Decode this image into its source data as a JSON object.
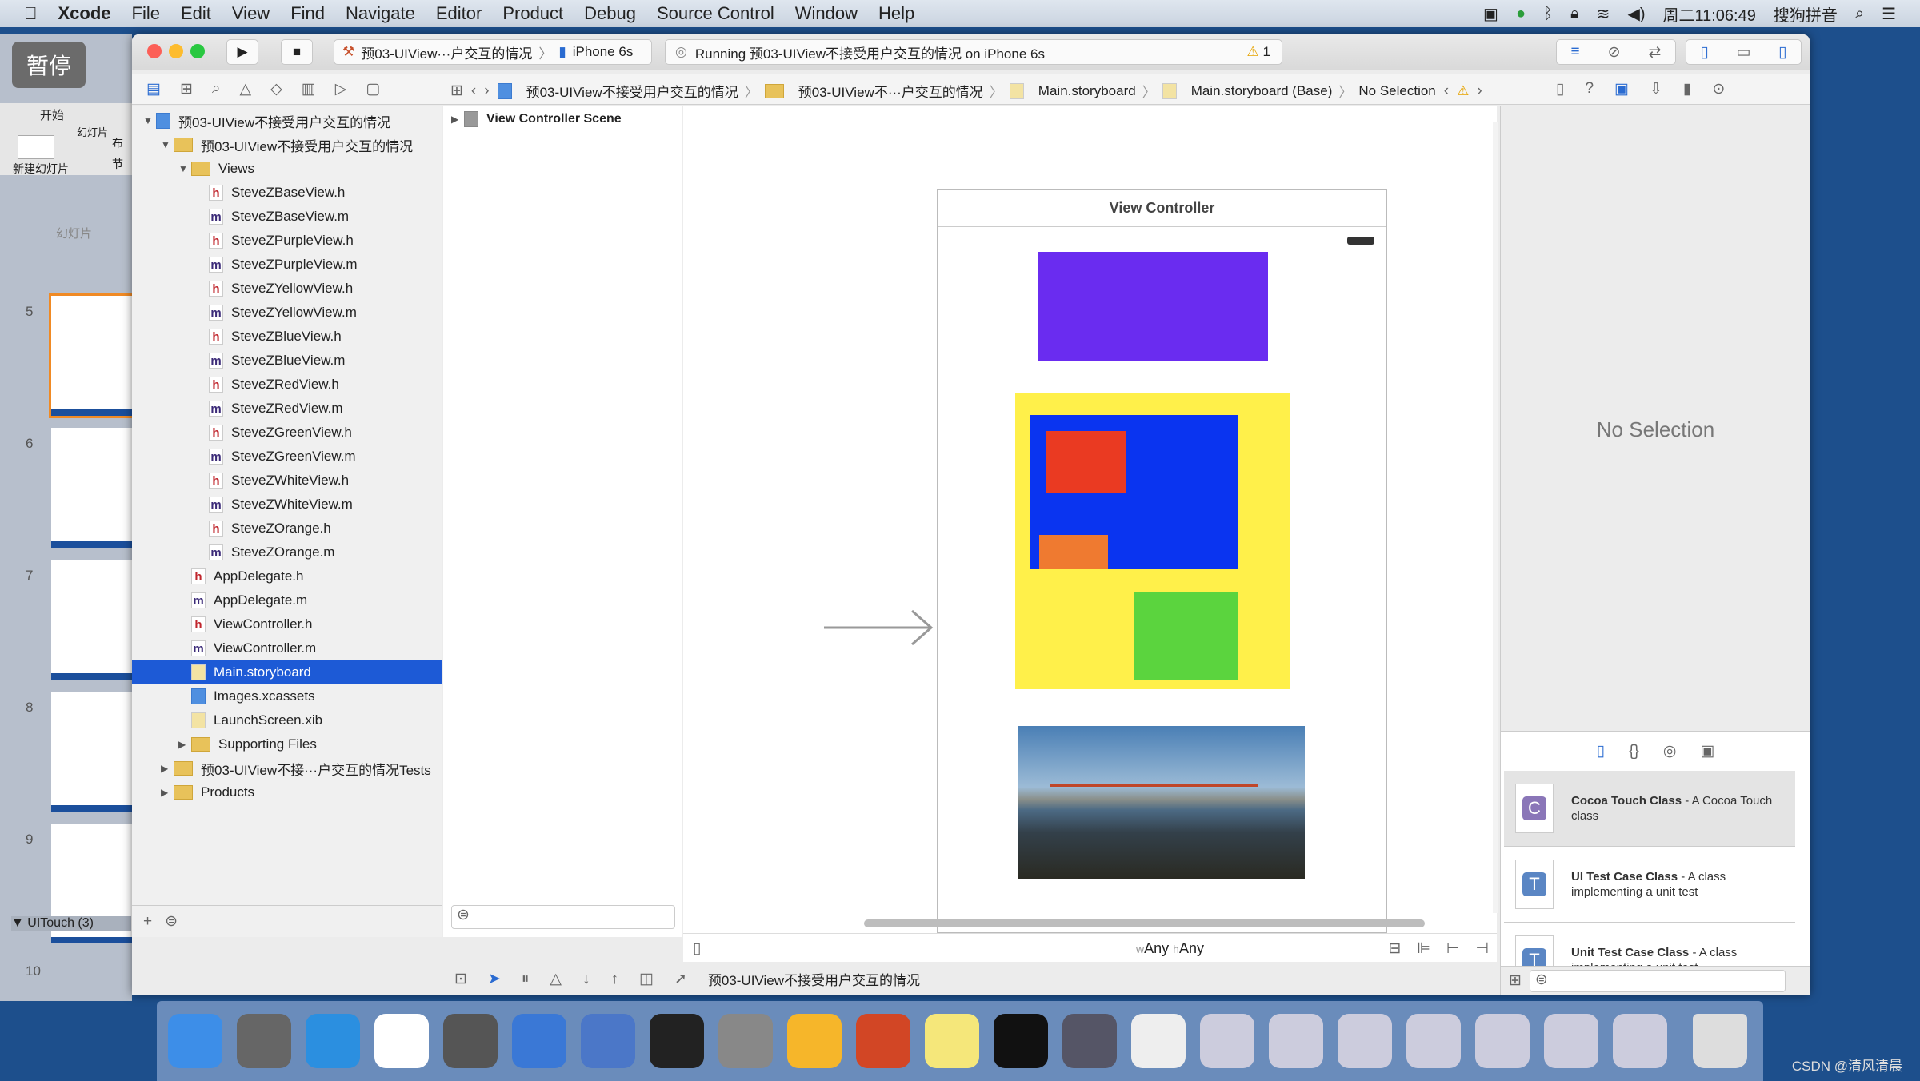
{
  "menubar": {
    "app": "Xcode",
    "items": [
      "File",
      "Edit",
      "View",
      "Find",
      "Navigate",
      "Editor",
      "Product",
      "Debug",
      "Source Control",
      "Window",
      "Help"
    ],
    "clock": "周二11:06:49",
    "ime": "搜狗拼音"
  },
  "overlay": {
    "pause": "暂停"
  },
  "ppt": {
    "home_tab": "开始",
    "group": "幻灯片",
    "new_slide": "新建幻灯片",
    "layout": "布",
    "section": "节",
    "pane_tab": "幻灯片",
    "slides": [
      "5",
      "6",
      "7",
      "8",
      "9",
      "10"
    ],
    "section_name": "UITouch (3)"
  },
  "toolbar": {
    "scheme": "预03-UIView···户交互的情况",
    "device": "iPhone 6s",
    "status": "Running 预03-UIView不接受用户交互的情况 on iPhone 6s",
    "warnings": "1"
  },
  "breadcrumb": [
    "预03-UIView不接受用户交互的情况",
    "预03-UIView不···户交互的情况",
    "Main.storyboard",
    "Main.storyboard (Base)",
    "No Selection"
  ],
  "navigator": {
    "tree": [
      {
        "label": "预03-UIView不接受用户交互的情况",
        "type": "proj",
        "depth": 0,
        "open": true
      },
      {
        "label": "预03-UIView不接受用户交互的情况",
        "type": "folder",
        "depth": 1,
        "open": true
      },
      {
        "label": "Views",
        "type": "folder",
        "depth": 2,
        "open": true
      },
      {
        "label": "SteveZBaseView.h",
        "type": "h",
        "depth": 3
      },
      {
        "label": "SteveZBaseView.m",
        "type": "m",
        "depth": 3
      },
      {
        "label": "SteveZPurpleView.h",
        "type": "h",
        "depth": 3
      },
      {
        "label": "SteveZPurpleView.m",
        "type": "m",
        "depth": 3
      },
      {
        "label": "SteveZYellowView.h",
        "type": "h",
        "depth": 3
      },
      {
        "label": "SteveZYellowView.m",
        "type": "m",
        "depth": 3
      },
      {
        "label": "SteveZBlueView.h",
        "type": "h",
        "depth": 3
      },
      {
        "label": "SteveZBlueView.m",
        "type": "m",
        "depth": 3
      },
      {
        "label": "SteveZRedView.h",
        "type": "h",
        "depth": 3
      },
      {
        "label": "SteveZRedView.m",
        "type": "m",
        "depth": 3
      },
      {
        "label": "SteveZGreenView.h",
        "type": "h",
        "depth": 3
      },
      {
        "label": "SteveZGreenView.m",
        "type": "m",
        "depth": 3
      },
      {
        "label": "SteveZWhiteView.h",
        "type": "h",
        "depth": 3
      },
      {
        "label": "SteveZWhiteView.m",
        "type": "m",
        "depth": 3
      },
      {
        "label": "SteveZOrange.h",
        "type": "h",
        "depth": 3
      },
      {
        "label": "SteveZOrange.m",
        "type": "m",
        "depth": 3
      },
      {
        "label": "AppDelegate.h",
        "type": "h",
        "depth": 2
      },
      {
        "label": "AppDelegate.m",
        "type": "m",
        "depth": 2
      },
      {
        "label": "ViewController.h",
        "type": "h",
        "depth": 2
      },
      {
        "label": "ViewController.m",
        "type": "m",
        "depth": 2
      },
      {
        "label": "Main.storyboard",
        "type": "sb",
        "depth": 2,
        "selected": true
      },
      {
        "label": "Images.xcassets",
        "type": "assets",
        "depth": 2
      },
      {
        "label": "LaunchScreen.xib",
        "type": "sb",
        "depth": 2
      },
      {
        "label": "Supporting Files",
        "type": "folder",
        "depth": 2,
        "open": false
      },
      {
        "label": "预03-UIView不接···户交互的情况Tests",
        "type": "folder",
        "depth": 1,
        "open": false
      },
      {
        "label": "Products",
        "type": "folder",
        "depth": 1,
        "open": false
      }
    ]
  },
  "scene": {
    "label": "View Controller Scene"
  },
  "canvas": {
    "vc_title": "View Controller",
    "size_w": "w",
    "size_w_val": "Any",
    "size_h": "h",
    "size_h_val": "Any",
    "colors": {
      "purple": "#6a2cf0",
      "yellow": "#fff04a",
      "blue": "#0a34f0",
      "red": "#ea3a22",
      "orange": "#ef7a30",
      "green": "#5bd43e"
    }
  },
  "debugbar": {
    "target": "预03-UIView不接受用户交互的情况"
  },
  "inspector": {
    "empty": "No Selection"
  },
  "library": [
    {
      "icon": "C",
      "color": "#8a76b8",
      "title": "Cocoa Touch Class",
      "desc": " - A Cocoa Touch class"
    },
    {
      "icon": "T",
      "color": "#5a86c4",
      "title": "UI Test Case Class",
      "desc": " - A class implementing a unit test"
    },
    {
      "icon": "T",
      "color": "#5a86c4",
      "title": "Unit Test Case Class",
      "desc": " - A class implementing a unit test"
    }
  ],
  "watermark": "CSDN @清风清晨"
}
